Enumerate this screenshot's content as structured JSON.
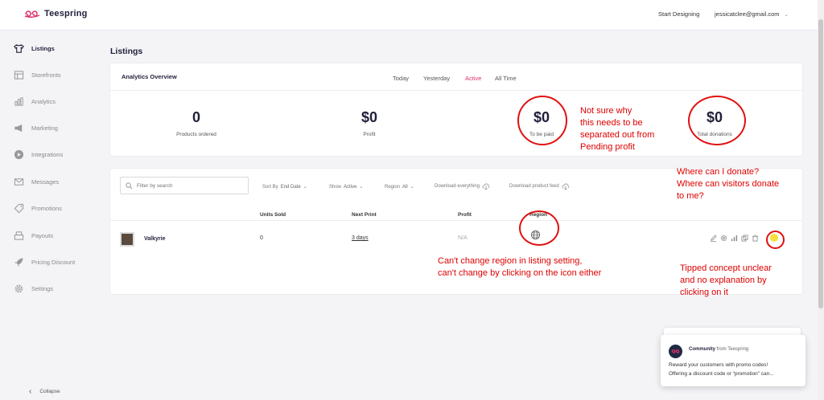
{
  "topbar": {
    "brand": "Teespring",
    "start_designing": "Start Designing",
    "user_email": "jessicatclee@gmail.com"
  },
  "sidebar": {
    "items": [
      {
        "label": "Listings",
        "icon": "shirt-icon"
      },
      {
        "label": "Storefronts",
        "icon": "storefront-icon"
      },
      {
        "label": "Analytics",
        "icon": "bar-chart-icon"
      },
      {
        "label": "Marketing",
        "icon": "megaphone-icon"
      },
      {
        "label": "Integrations",
        "icon": "play-icon"
      },
      {
        "label": "Messages",
        "icon": "envelope-icon"
      },
      {
        "label": "Promotions",
        "icon": "tag-icon"
      },
      {
        "label": "Payouts",
        "icon": "register-icon"
      },
      {
        "label": "Pricing Discount",
        "icon": "rocket-icon"
      },
      {
        "label": "Settings",
        "icon": "gear-icon"
      }
    ],
    "collapse_label": "Collapse"
  },
  "page_title": "Listings",
  "analytics": {
    "title": "Analytics Overview",
    "tabs": [
      "Today",
      "Yesterday",
      "Active",
      "All Time"
    ],
    "active_tab": "Active",
    "stats": [
      {
        "value": "0",
        "label": "Products ordered"
      },
      {
        "value": "$0",
        "label": "Profit"
      },
      {
        "value": "$0",
        "label": "To be paid"
      },
      {
        "value": "$0",
        "label": "Total donations"
      }
    ]
  },
  "listings": {
    "search_placeholder": "Filter by search",
    "sort_label": "Sort By",
    "sort_value": "End Date",
    "show_label": "Show",
    "show_value": "Active",
    "region_label": "Region",
    "region_value": "All",
    "download_everything": "Download everything",
    "download_feed": "Download product feed",
    "columns": [
      "Units Sold",
      "Next Print",
      "Profit",
      "Region"
    ],
    "row": {
      "name": "Valkyrie",
      "units_sold": "0",
      "next_print": "3 days",
      "profit": "N/A"
    }
  },
  "annotations": {
    "to_be_paid": [
      "Not sure why",
      "this needs to be",
      "separated out from",
      "Pending profit"
    ],
    "donations": [
      "Where can I donate?",
      "Where can visitors donate",
      "to me?"
    ],
    "region": [
      "Can't change region in listing setting,",
      "can't change by clicking on the icon either"
    ],
    "tipped": [
      "Tipped concept unclear",
      "and no explanation by",
      "clicking on it"
    ]
  },
  "community_popup": {
    "source": "Community",
    "from_label": "from Teespring",
    "message_line1": "Reward your customers with promo codes!",
    "message_line2": "Offering a discount code or “promotion” can..."
  },
  "colors": {
    "accent": "#e0306c",
    "navy": "#1f1f3a",
    "annotation": "#e01010"
  }
}
